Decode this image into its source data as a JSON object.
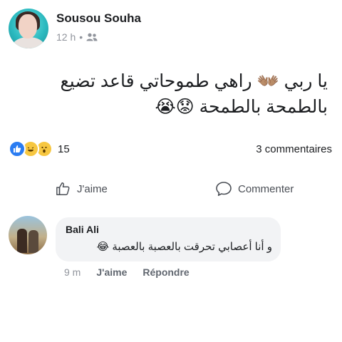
{
  "post": {
    "author": "Sousou Souha",
    "time": "12 h",
    "separator": "•",
    "audience_icon": "friends-icon",
    "text_line1": "يا ربي 👐🏽 راهي طموحاتي قاعد تضيع",
    "text_line2": "بالطمحة بالطمحة 😟😭"
  },
  "reactions": {
    "types": [
      "like",
      "haha",
      "wow"
    ],
    "count": "15",
    "comments_label": "3 commentaires"
  },
  "actions": {
    "like_label": "J'aime",
    "comment_label": "Commenter"
  },
  "comment": {
    "author": "Bali Ali",
    "text": "و أنا أعصابي تحرقت بالعصبة بالعصبة 😂",
    "time": "9 m",
    "like_label": "J'aime",
    "reply_label": "Répondre"
  },
  "colors": {
    "like_blue": "#2a7cf2",
    "reaction_yellow": "#f7c741",
    "muted_text": "#90949c",
    "bubble_bg": "#f2f3f5"
  }
}
